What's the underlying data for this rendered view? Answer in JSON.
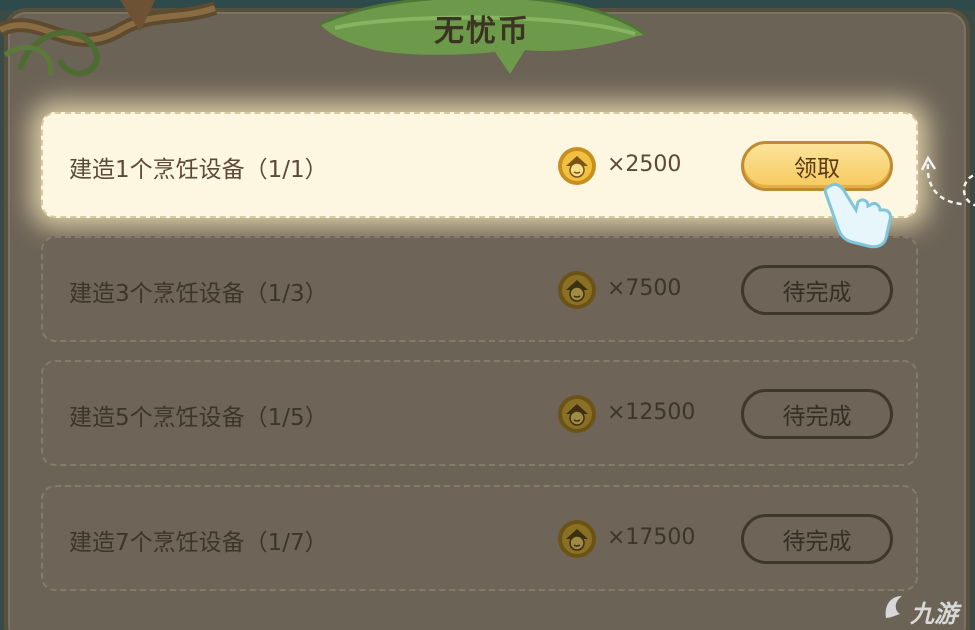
{
  "header": {
    "title": "无忧币"
  },
  "tasks": [
    {
      "label": "建造1个烹饪设备（1/1）",
      "reward": "×2500",
      "button": "领取",
      "state": "claimable"
    },
    {
      "label": "建造3个烹饪设备（1/3）",
      "reward": "×7500",
      "button": "待完成",
      "state": "pending"
    },
    {
      "label": "建造5个烹饪设备（1/5）",
      "reward": "×12500",
      "button": "待完成",
      "state": "pending"
    },
    {
      "label": "建造7个烹饪设备（1/7）",
      "reward": "×17500",
      "button": "待完成",
      "state": "pending"
    }
  ],
  "icons": {
    "coin": "coin-icon",
    "hand": "pointing-hand-icon",
    "arrow": "curved-arrow-icon"
  },
  "colors": {
    "panel": "#6c6357",
    "active_row": "#fdf6e1",
    "claim_button": "#f6c95d",
    "coin": "#e8b431"
  },
  "watermark": {
    "text": "九游"
  }
}
